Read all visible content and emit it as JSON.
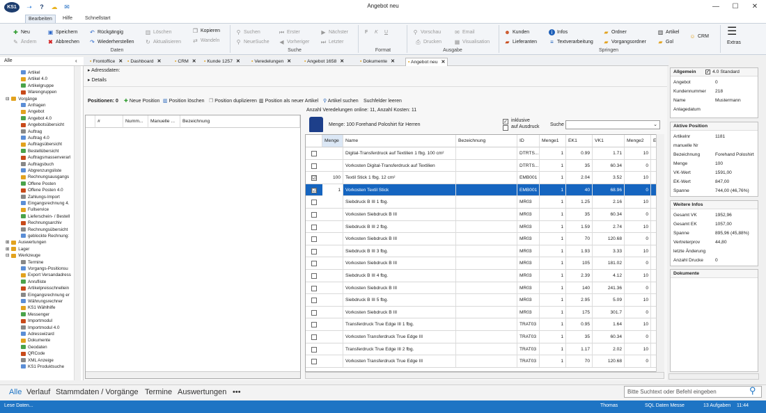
{
  "window": {
    "title": "Angebot neu",
    "app_logo": "KS1",
    "min": "—",
    "max": "☐",
    "close": "✕"
  },
  "quick_access": [
    {
      "icon": "arrow-icon",
      "glyph": "➝"
    },
    {
      "icon": "help-icon",
      "glyph": "?"
    },
    {
      "icon": "cloud-icon",
      "glyph": "☁"
    },
    {
      "icon": "outlook-icon",
      "glyph": "✉"
    }
  ],
  "ribbon_tabs": [
    "Bearbeiten",
    "Hilfe",
    "Schnellstart"
  ],
  "ribbon": {
    "daten": {
      "neu": "Neu",
      "andern": "Ändern",
      "speichern": "Speichern",
      "abbrechen": "Abbrechen",
      "ruckgangig": "Rückgängig",
      "wiederherstellen": "Wiederherstellen",
      "loschen": "Löschen",
      "aktualisieren": "Aktualisieren",
      "kopieren": "Kopieren",
      "wandeln": "Wandeln",
      "group": "Daten"
    },
    "suche": {
      "suchen": "Suchen",
      "neuesuche": "NeueSuche",
      "erster": "Erster",
      "vorheriger": "Vorheriger",
      "nachster": "Nächster",
      "letzter": "Letzter",
      "group": "Suche"
    },
    "format": {
      "b": "F",
      "i": "K",
      "u": "U",
      "group": "Format"
    },
    "ausgabe": {
      "vorschau": "Vorschau",
      "email": "Email",
      "drucken": "Drucken",
      "visualisation": "Visualisation",
      "group": "Ausgabe"
    },
    "springen": {
      "kunden": "Kunden",
      "lieferanten": "Lieferanten",
      "infos": "Infos",
      "textverarbeitung": "Textverarbeitung",
      "ordner": "Ordner",
      "vorgangsordner": "Vorgangsordner",
      "artikel": "Artikel",
      "gol": "Gol",
      "crm": "CRM",
      "group": "Springen"
    },
    "extras": "Extras"
  },
  "nav": {
    "header": "Alle",
    "items": [
      {
        "label": "Artikel",
        "lvl": 2
      },
      {
        "label": "Artikel 4.0",
        "lvl": 2
      },
      {
        "label": "Artikelgruppe",
        "lvl": 2
      },
      {
        "label": "Warengruppen",
        "lvl": 2
      },
      {
        "label": "Vorgänge",
        "lvl": 0,
        "exp": "⊟"
      },
      {
        "label": "Anfragen",
        "lvl": 2
      },
      {
        "label": "Angebot",
        "lvl": 2
      },
      {
        "label": "Angebot 4.0",
        "lvl": 2
      },
      {
        "label": "Angebotsübersicht",
        "lvl": 2
      },
      {
        "label": "Auftrag",
        "lvl": 2
      },
      {
        "label": "Auftrag 4.0",
        "lvl": 2
      },
      {
        "label": "Auftragsübersicht",
        "lvl": 2
      },
      {
        "label": "Bestellübersicht",
        "lvl": 2
      },
      {
        "label": "Auftragsmassenverarl",
        "lvl": 2
      },
      {
        "label": "Auftragsbuch",
        "lvl": 2
      },
      {
        "label": "Abgrenzungsliste",
        "lvl": 2
      },
      {
        "label": "Rechnungsausgangs",
        "lvl": 2
      },
      {
        "label": "Offene Posten",
        "lvl": 2
      },
      {
        "label": "Offene Posten 4.0",
        "lvl": 2
      },
      {
        "label": "Zahlungs-Import",
        "lvl": 2
      },
      {
        "label": "Eingangsrechnung 4.",
        "lvl": 2
      },
      {
        "label": "Fullservice",
        "lvl": 2
      },
      {
        "label": "Lieferschein- / Bestell",
        "lvl": 2
      },
      {
        "label": "Rechnungsarchiv",
        "lvl": 2
      },
      {
        "label": "Rechnungsübersicht",
        "lvl": 2
      },
      {
        "label": "geblockte Rechnung:",
        "lvl": 2
      },
      {
        "label": "Auswertungen",
        "lvl": 0,
        "exp": "⊞"
      },
      {
        "label": "Lager",
        "lvl": 0,
        "exp": "⊞"
      },
      {
        "label": "Werkzeuge",
        "lvl": 0,
        "exp": "⊟"
      },
      {
        "label": "Termine",
        "lvl": 2
      },
      {
        "label": "Vorgangs-Positionsu",
        "lvl": 2
      },
      {
        "label": "Export Versandadress",
        "lvl": 2
      },
      {
        "label": "Anrufliste",
        "lvl": 2
      },
      {
        "label": "Artikelpreisschnellein",
        "lvl": 2
      },
      {
        "label": "Eingangsrechnung er",
        "lvl": 2
      },
      {
        "label": "Währungsrechner",
        "lvl": 2
      },
      {
        "label": "KS1 Wählhilfe",
        "lvl": 2
      },
      {
        "label": "Messenger",
        "lvl": 2
      },
      {
        "label": "Importmodul",
        "lvl": 2
      },
      {
        "label": "Importmodul 4.0",
        "lvl": 2
      },
      {
        "label": "Adresswizard",
        "lvl": 2
      },
      {
        "label": "Dokumente",
        "lvl": 2
      },
      {
        "label": "Geodaten",
        "lvl": 2
      },
      {
        "label": "QRCode",
        "lvl": 2
      },
      {
        "label": "XML Anzeige",
        "lvl": 2
      },
      {
        "label": "KS1 Produktsuche",
        "lvl": 2
      }
    ]
  },
  "doc_tabs": [
    {
      "label": "Frontoffice",
      "x": 0
    },
    {
      "label": "Dashboard",
      "x": 0
    },
    {
      "label": "CRM",
      "x": 0
    },
    {
      "label": "Kunde 1257",
      "x": 0
    },
    {
      "label": "Veredelungen",
      "x": 0
    },
    {
      "label": "Angebot 1658",
      "x": 0
    },
    {
      "label": "Dokumente",
      "x": 0
    },
    {
      "label": "Angebot neu",
      "x": 0
    }
  ],
  "sections": {
    "adress": "Adressdaten:",
    "details": "Details"
  },
  "pos_bar": {
    "count": "Positionen: 0",
    "neue": "Neue Position",
    "loschen": "Position löschen",
    "duplizieren": "Position duplizieren",
    "neuer_artikel": "Position als neuer Artikel",
    "artikel_suchen": "Artikel suchen",
    "suchfelder": "Suchfelder leeren"
  },
  "left_grid": {
    "headers": [
      "#",
      "Numm...",
      "Manuelle ...",
      "Bezeichnung"
    ]
  },
  "veredelungen": {
    "info": "Anzahl Veredelungen online: 11, Anzahl Kosten: 11",
    "menge_text": "Menge: 100 Forehand Poloshirt für Herren",
    "inklusive": "inklusive",
    "auf_ausdruck": "auf Ausdruck",
    "suche": "Suche"
  },
  "grid": {
    "headers": [
      "",
      "Menge",
      "Name",
      "Bezeichnung",
      "ID",
      "Menge1",
      "EK1",
      "VK1",
      "Menge2",
      "E"
    ],
    "rows": [
      {
        "check": "",
        "menge": "",
        "name": "Digital-Transferdruck auf Textilien 1 fbg. 100 cm²",
        "bez": "",
        "id": "DTRTS...",
        "m1": "1",
        "ek1": "0.99",
        "vk1": "1.71",
        "m2": "10"
      },
      {
        "check": "",
        "menge": "",
        "name": "Vorkosten Digital-Transferdruck auf Textilien",
        "bez": "",
        "id": "DTRTS...",
        "m1": "1",
        "ek1": "35",
        "vk1": "60.34",
        "m2": "0"
      },
      {
        "check": "☑",
        "menge": "100",
        "name": "Textil Stick 1 fbg. 12 cm²",
        "bez": "",
        "id": "EMB001",
        "m1": "1",
        "ek1": "2.04",
        "vk1": "3.52",
        "m2": "10"
      },
      {
        "check": "☑",
        "menge": "1",
        "name": "Vorkosten Textil Stick",
        "bez": "",
        "id": "EMB001",
        "m1": "1",
        "ek1": "40",
        "vk1": "68.96",
        "m2": "0",
        "sel": true
      },
      {
        "check": "",
        "menge": "",
        "name": "Siebdruck B III 1 fbg.",
        "bez": "",
        "id": "MR03",
        "m1": "1",
        "ek1": "1.25",
        "vk1": "2.16",
        "m2": "10"
      },
      {
        "check": "",
        "menge": "",
        "name": "Vorkosten Siebdruck B III",
        "bez": "",
        "id": "MR03",
        "m1": "1",
        "ek1": "35",
        "vk1": "60.34",
        "m2": "0"
      },
      {
        "check": "",
        "menge": "",
        "name": "Siebdruck B III 2 fbg.",
        "bez": "",
        "id": "MR03",
        "m1": "1",
        "ek1": "1.59",
        "vk1": "2.74",
        "m2": "10"
      },
      {
        "check": "",
        "menge": "",
        "name": "Vorkosten Siebdruck B III",
        "bez": "",
        "id": "MR03",
        "m1": "1",
        "ek1": "70",
        "vk1": "120.68",
        "m2": "0"
      },
      {
        "check": "",
        "menge": "",
        "name": "Siebdruck B III 3 fbg.",
        "bez": "",
        "id": "MR03",
        "m1": "1",
        "ek1": "1.93",
        "vk1": "3.33",
        "m2": "10"
      },
      {
        "check": "",
        "menge": "",
        "name": "Vorkosten Siebdruck B III",
        "bez": "",
        "id": "MR03",
        "m1": "1",
        "ek1": "105",
        "vk1": "181.02",
        "m2": "0"
      },
      {
        "check": "",
        "menge": "",
        "name": "Siebdruck B III 4 fbg.",
        "bez": "",
        "id": "MR03",
        "m1": "1",
        "ek1": "2.39",
        "vk1": "4.12",
        "m2": "10"
      },
      {
        "check": "",
        "menge": "",
        "name": "Vorkosten Siebdruck B III",
        "bez": "",
        "id": "MR03",
        "m1": "1",
        "ek1": "140",
        "vk1": "241.36",
        "m2": "0"
      },
      {
        "check": "",
        "menge": "",
        "name": "Siebdruck B III 5 fbg.",
        "bez": "",
        "id": "MR03",
        "m1": "1",
        "ek1": "2.95",
        "vk1": "5.09",
        "m2": "10"
      },
      {
        "check": "",
        "menge": "",
        "name": "Vorkosten Siebdruck B III",
        "bez": "",
        "id": "MR03",
        "m1": "1",
        "ek1": "175",
        "vk1": "301.7",
        "m2": "0"
      },
      {
        "check": "",
        "menge": "",
        "name": "Transferdruck True Edge III 1 fbg.",
        "bez": "",
        "id": "TRAT03",
        "m1": "1",
        "ek1": "0.95",
        "vk1": "1.64",
        "m2": "10"
      },
      {
        "check": "",
        "menge": "",
        "name": "Vorkosten Transferdruck True Edge III",
        "bez": "",
        "id": "TRAT03",
        "m1": "1",
        "ek1": "35",
        "vk1": "60.34",
        "m2": "0"
      },
      {
        "check": "",
        "menge": "",
        "name": "Transferdruck True Edge III 2 fbg.",
        "bez": "",
        "id": "TRAT03",
        "m1": "1",
        "ek1": "1.17",
        "vk1": "2.02",
        "m2": "10"
      },
      {
        "check": "",
        "menge": "",
        "name": "Vorkosten Transferdruck True Edge III",
        "bez": "",
        "id": "TRAT03",
        "m1": "1",
        "ek1": "70",
        "vk1": "120.68",
        "m2": "0"
      }
    ]
  },
  "side": {
    "allgemein": {
      "title": "Allgemein",
      "std": "4.0 Standard",
      "rows": [
        [
          "Angebot",
          "0"
        ],
        [
          "Kundennummer",
          "218"
        ],
        [
          "Name",
          "Mustermann"
        ],
        [
          "Anlagedatum",
          ""
        ]
      ]
    },
    "aktive": {
      "title": "Aktive Position",
      "rows": [
        [
          "Artikelnr",
          "1181"
        ],
        [
          "manuelle Nr",
          ""
        ],
        [
          "Bezeichnung",
          "Forehand Poloshirt"
        ],
        [
          "Menge",
          "100"
        ],
        [
          "VK-Wert",
          "1591,00"
        ],
        [
          "EK-Wert",
          "847,00"
        ],
        [
          "Spanne",
          "744,00 (46,76%)"
        ]
      ]
    },
    "weitere": {
      "title": "Weitere Infos",
      "rows": [
        [
          "Gesamt VK",
          "1952,96"
        ],
        [
          "Gesamt EK",
          "1057,00"
        ],
        [
          "Spanne",
          "895,96 (45,88%)"
        ],
        [
          "Vertreterprov",
          "44,80"
        ],
        [
          "letzte Änderung",
          ""
        ],
        [
          "Anzahl Drucke",
          "0"
        ]
      ]
    },
    "dokumente": {
      "title": "Dokumente"
    }
  },
  "bottom_nav": [
    "Alle",
    "Verlauf",
    "Stammdaten / Vorgänge",
    "Termine",
    "Auswertungen",
    "•••"
  ],
  "command_placeholder": "Bitte Suchtext oder Befehl eingeben",
  "status": {
    "left": "Lese Daten...",
    "user": "Thomas",
    "db": "SQL Daten Messe",
    "tasks": "13 Aufgaben",
    "time": "11:44"
  },
  "colors": {
    "accent": "#1e74c4",
    "selected": "#1565c0"
  }
}
